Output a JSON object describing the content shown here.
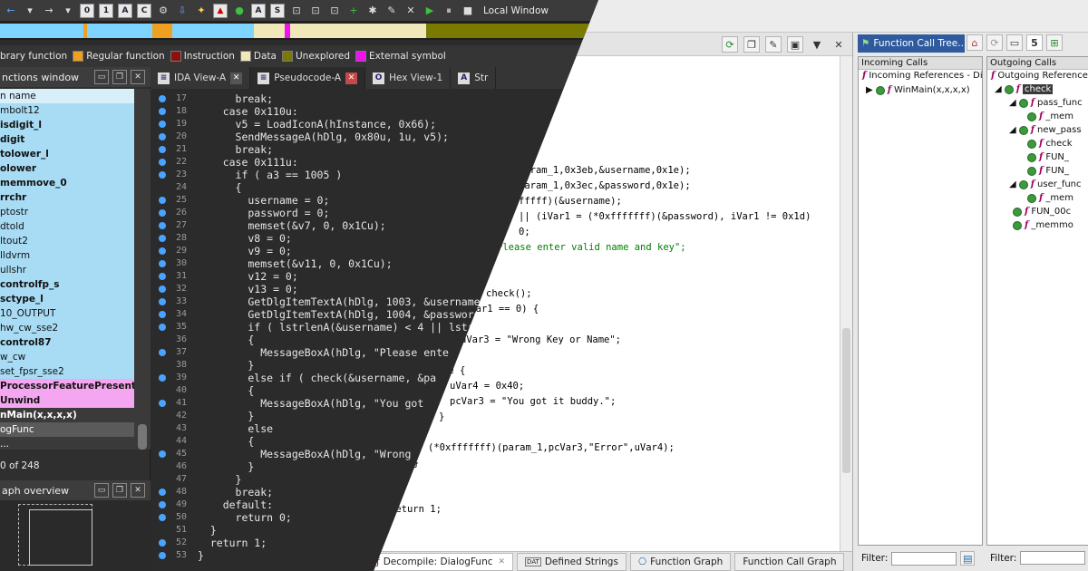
{
  "ghidra": {
    "code_lines": [
      {
        "text": "param_1,0x3eb,&username,0x1e);"
      },
      {
        "text": "param_1,0x3ec,&password,0x1e);"
      },
      {
        "text": "fffff)(&username);"
      },
      {
        "text": "|| (iVar1 = (*0xfffffff)(&password), iVar1 != 0x1d)"
      },
      {
        "text": "0;"
      },
      {
        "text": "Please enter valid name and key\";"
      },
      {
        "text": "check();"
      },
      {
        "text": "iVar1 == 0) {"
      },
      {
        "text": "uVar3 = \"Wrong Key or Name\";"
      },
      {
        "text": "se {"
      },
      {
        "text": "uVar4 = 0x40;"
      },
      {
        "text": "pcVar3 = \"You got it buddy.\";"
      },
      {
        "text": "}"
      },
      {
        "text": "(*0xfffffff)(param_1,pcVar3,\"Error\",uVar4);"
      },
      {
        "text": "}"
      },
      {
        "text": "return 1;"
      }
    ],
    "bottom_tabs": [
      {
        "label": "Decompile: DialogFunc",
        "selected": true
      },
      {
        "label": "Defined Strings"
      },
      {
        "label": "Function Graph"
      },
      {
        "label": "Function Call Graph"
      }
    ],
    "fct": {
      "title": "Function Call Tree...",
      "count": "5",
      "incoming": {
        "header": "Incoming Calls",
        "root": "Incoming References - Di",
        "items": [
          "WinMain(x,x,x,x)"
        ]
      },
      "outgoing": {
        "header": "Outgoing Calls",
        "root": "Outgoing Reference",
        "items": [
          "check",
          "pass_func",
          "_mem",
          "new_pass",
          "check",
          "FUN_",
          "FUN_",
          "user_func",
          "_mem",
          "FUN_00c",
          "_memmo"
        ]
      },
      "filter_label": "Filter:"
    }
  },
  "ida": {
    "toolbar": {
      "local_window": "Local Window"
    },
    "legend": [
      {
        "label": "brary function",
        "color": "#7fd3ff"
      },
      {
        "label": "Regular function",
        "color": "#f0a020"
      },
      {
        "label": "Instruction",
        "color": "#8b1010"
      },
      {
        "label": "Data",
        "color": "#f0e8b8"
      },
      {
        "label": "Unexplored",
        "color": "#7a7a00"
      },
      {
        "label": "External symbol",
        "color": "#f010f0"
      }
    ],
    "functions_window": {
      "title": "nctions window",
      "column": "n name",
      "items": [
        {
          "name": "mbolt12"
        },
        {
          "name": "isdigit_l",
          "bold": true
        },
        {
          "name": "digit",
          "bold": true
        },
        {
          "name": "tolower_l",
          "bold": true
        },
        {
          "name": "olower",
          "bold": true
        },
        {
          "name": "memmove_0",
          "bold": true
        },
        {
          "name": "rrchr",
          "bold": true
        },
        {
          "name": "ptostr"
        },
        {
          "name": "dtold"
        },
        {
          "name": "ltout2"
        },
        {
          "name": "lldvrm"
        },
        {
          "name": "ullshr"
        },
        {
          "name": "controlfp_s",
          "bold": true
        },
        {
          "name": "sctype_l",
          "bold": true
        },
        {
          "name": "10_OUTPUT"
        },
        {
          "name": "hw_cw_sse2"
        },
        {
          "name": "control87",
          "bold": true
        },
        {
          "name": "w_cw"
        },
        {
          "name": "set_fpsr_sse2"
        },
        {
          "name": "ProcessorFeaturePresent",
          "bold": true,
          "pink": true
        },
        {
          "name": "Unwind",
          "bold": true,
          "pink": true
        },
        {
          "name": "nMain(x,x,x,x)",
          "bold": true,
          "sel": true
        },
        {
          "name": "ogFunc",
          "sel": true
        },
        {
          "name": "..."
        }
      ],
      "count": "0 of 248"
    },
    "graph_overview": "aph overview",
    "tabs": [
      {
        "label": "IDA View-A"
      },
      {
        "label": "Pseudocode-A",
        "selected": true
      },
      {
        "label": "Hex View-1"
      },
      {
        "label": "Str"
      }
    ],
    "code": [
      {
        "no": "17",
        "text": "      break;",
        "dot": true
      },
      {
        "no": "18",
        "text": "    case 0x110u:",
        "dot": true
      },
      {
        "no": "19",
        "text": "      v5 = LoadIconA(hInstance, 0x66);",
        "dot": true
      },
      {
        "no": "20",
        "text": "      SendMessageA(hDlg, 0x80u, 1u, v5);",
        "dot": true
      },
      {
        "no": "21",
        "text": "      break;",
        "dot": true
      },
      {
        "no": "22",
        "text": "    case 0x111u:",
        "dot": true
      },
      {
        "no": "23",
        "text": "      if ( a3 == 1005 )",
        "dot": true
      },
      {
        "no": "24",
        "text": "      {",
        "dot": false
      },
      {
        "no": "25",
        "text": "        username = 0;",
        "dot": true
      },
      {
        "no": "26",
        "text": "        password = 0;",
        "dot": true
      },
      {
        "no": "27",
        "text": "        memset(&v7, 0, 0x1Cu);",
        "dot": true
      },
      {
        "no": "28",
        "text": "        v8 = 0;",
        "dot": true
      },
      {
        "no": "29",
        "text": "        v9 = 0;",
        "dot": true
      },
      {
        "no": "30",
        "text": "        memset(&v11, 0, 0x1Cu);",
        "dot": true
      },
      {
        "no": "31",
        "text": "        v12 = 0;",
        "dot": true
      },
      {
        "no": "32",
        "text": "        v13 = 0;",
        "dot": true
      },
      {
        "no": "33",
        "text": "        GetDlgItemTextA(hDlg, 1003, &username",
        "dot": true
      },
      {
        "no": "34",
        "text": "        GetDlgItemTextA(hDlg, 1004, &password",
        "dot": true
      },
      {
        "no": "35",
        "text": "        if ( lstrlenA(&username) < 4 || lstr",
        "dot": true
      },
      {
        "no": "36",
        "text": "        {",
        "dot": false
      },
      {
        "no": "37",
        "text": "          MessageBoxA(hDlg, \"Please ente",
        "dot": true
      },
      {
        "no": "38",
        "text": "        }",
        "dot": false
      },
      {
        "no": "39",
        "text": "        else if ( check(&username, &pa",
        "dot": true
      },
      {
        "no": "40",
        "text": "        {",
        "dot": false
      },
      {
        "no": "41",
        "text": "          MessageBoxA(hDlg, \"You got",
        "dot": true
      },
      {
        "no": "42",
        "text": "        }",
        "dot": false
      },
      {
        "no": "43",
        "text": "        else",
        "dot": false
      },
      {
        "no": "44",
        "text": "        {",
        "dot": false
      },
      {
        "no": "45",
        "text": "          MessageBoxA(hDlg, \"Wrong",
        "dot": true
      },
      {
        "no": "46",
        "text": "        }",
        "dot": false
      },
      {
        "no": "47",
        "text": "      }",
        "dot": false
      },
      {
        "no": "48",
        "text": "      break;",
        "dot": true
      },
      {
        "no": "49",
        "text": "    default:",
        "dot": true
      },
      {
        "no": "50",
        "text": "      return 0;",
        "dot": true
      },
      {
        "no": "51",
        "text": "  }",
        "dot": false
      },
      {
        "no": "52",
        "text": "  return 1;",
        "dot": true
      },
      {
        "no": "53",
        "text": "}",
        "dot": true
      }
    ]
  }
}
